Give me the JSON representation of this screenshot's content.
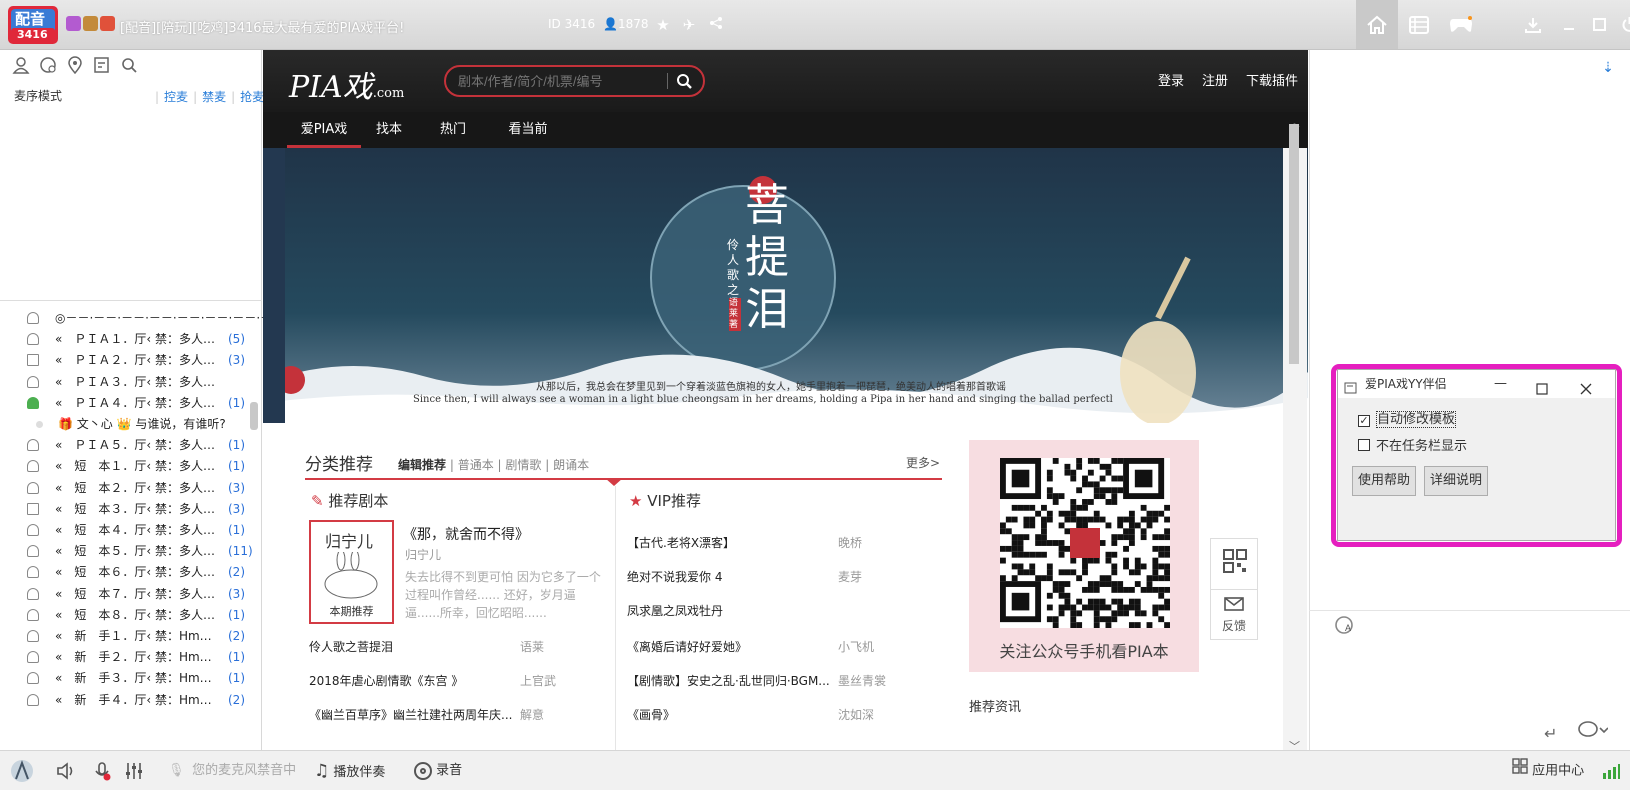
{
  "titlebar": {
    "logo_text": "配音",
    "logo_num": "3416",
    "title": "[配音][陪玩][吃鸡]3416最大最有爱的PIA戏平台!",
    "id": "ID 3416",
    "users": "1878",
    "right_icons": [
      "home-icon",
      "list-icon",
      "gamepad-icon",
      "download-icon",
      "minimize-icon",
      "maximize-icon",
      "power-icon"
    ]
  },
  "left": {
    "tools": [
      "user-icon",
      "chat-icon",
      "location-icon",
      "notes-icon",
      "search-icon"
    ],
    "mic_mode": "麦序模式",
    "links": [
      "控麦",
      "禁麦",
      "抢麦"
    ],
    "channels": [
      {
        "label": "◎－－·－－·－－·－－·－－·－－·－－·－－·－－·…",
        "num": "",
        "icon": "headset"
      },
      {
        "label": "«　ＰＩＡ１．厅‹ 禁：多人…",
        "num": "(5)",
        "icon": "headset"
      },
      {
        "label": "«　ＰＩＡ２．厅‹ 禁：多人…",
        "num": "(3)",
        "icon": "plus"
      },
      {
        "label": "«　ＰＩＡ３．厅‹ 禁：多人…",
        "num": "",
        "icon": "headset"
      },
      {
        "label": "«　ＰＩＡ４．厅‹ 禁：多人…",
        "num": "(1)",
        "icon": "green"
      },
      {
        "label": "🎁 文丶心 👑 与谁说，有谁听?",
        "num": "",
        "icon": "none"
      },
      {
        "label": "«　ＰＩＡ５．厅‹ 禁：多人…",
        "num": "(1)",
        "icon": "headset"
      },
      {
        "label": "«　短　本１．厅‹ 禁：多人…",
        "num": "(1)",
        "icon": "headset"
      },
      {
        "label": "«　短　本２．厅‹ 禁：多人…",
        "num": "(3)",
        "icon": "headset"
      },
      {
        "label": "«　短　本３．厅‹ 禁：多人…",
        "num": "(3)",
        "icon": "plus"
      },
      {
        "label": "«　短　本４．厅‹ 禁：多人…",
        "num": "(1)",
        "icon": "headset"
      },
      {
        "label": "«　短　本５．厅‹ 禁：多人…",
        "num": "(11)",
        "icon": "headset"
      },
      {
        "label": "«　短　本６．厅‹ 禁：多人…",
        "num": "(2)",
        "icon": "headset"
      },
      {
        "label": "«　短　本７．厅‹ 禁：多人…",
        "num": "(3)",
        "icon": "headset"
      },
      {
        "label": "«　短　本８．厅‹ 禁：多人…",
        "num": "(1)",
        "icon": "headset"
      },
      {
        "label": "«　新　手１．厅‹ 禁：Hm…",
        "num": "(2)",
        "icon": "headset"
      },
      {
        "label": "«　新　手２．厅‹ 禁：Hm…",
        "num": "(1)",
        "icon": "headset"
      },
      {
        "label": "«　新　手３．厅‹ 禁：Hm…",
        "num": "(1)",
        "icon": "headset"
      },
      {
        "label": "«　新　手４．厅‹ 禁：Hm…",
        "num": "(2)",
        "icon": "headset"
      }
    ]
  },
  "site": {
    "logo": "PIA戏",
    "logo_suffix": ".com",
    "search_placeholder": "剧本/作者/简介/机票/编号",
    "links": [
      "登录",
      "注册",
      "下载插件"
    ],
    "nav": [
      "爱PIA戏",
      "找本",
      "热门",
      "看当前"
    ],
    "banner": {
      "title": "菩提泪",
      "subtitle": "伶人歌之",
      "seal": "语莱著",
      "cn_line": "从那以后，我总会在梦里见到一个穿着淡蓝色旗袍的女人，她手里抱着一把琵琶，绝美动人的唱着那首歌谣",
      "en_line": "Since then, I will always see a woman in a light blue cheongsam in her dreams, holding a Pipa in her hand and singing the ballad perfectly."
    },
    "category": {
      "title": "分类推荐",
      "tabs": [
        "编辑推荐",
        "普通本",
        "剧情歌",
        "朗诵本"
      ],
      "more": "更多>"
    },
    "rec": {
      "title": "推荐剧本",
      "book_text": "归宁儿",
      "book_tag": "本期推荐",
      "feat_title": "《那，就舍而不得》",
      "feat_author": "归宁儿",
      "feat_desc": "失去比得不到更可怕 因为它多了一个过程叫作曾经...... 还好，岁月逼逼......所幸，回忆昭昭......",
      "list": [
        {
          "title": "伶人歌之菩提泪",
          "author": "语莱"
        },
        {
          "title": "2018年虐心剧情歌《东宫 》",
          "author": "上官武"
        },
        {
          "title": "《幽兰百草序》幽兰社建社两周年庆...",
          "author": "解意"
        }
      ]
    },
    "vip": {
      "title": "VIP推荐",
      "list": [
        {
          "title": "【古代.老将X漂客】",
          "author": "晚桥"
        },
        {
          "title": "绝对不说我爱你 4",
          "author": "麦芽"
        },
        {
          "title": "凤求凰之凤戏牡丹",
          "author": ""
        },
        {
          "title": "《离婚后请好好爱她》",
          "author": "小飞机"
        },
        {
          "title": "【剧情歌】安史之乱·乱世同归·BGM...",
          "author": "墨丝青裳"
        },
        {
          "title": "《画骨》",
          "author": "沈如深"
        }
      ]
    },
    "qr_caption": "关注公众号手机看PIA本",
    "news_title": "推荐资讯",
    "float": {
      "feedback": "反馈"
    }
  },
  "dialog": {
    "title": "爱PIA戏YY伴侣",
    "cb1": "自动修改模板",
    "cb1_checked": true,
    "cb2": "不在任务栏显示",
    "cb2_checked": false,
    "btn1": "使用帮助",
    "btn2": "详细说明"
  },
  "bottom": {
    "mic_status": "您的麦克风禁音中",
    "play": "播放伴奏",
    "record": "录音",
    "app_center": "应用中心"
  },
  "colors": {
    "accent": "#c4323a",
    "dialog_highlight": "#e51fbf",
    "link": "#2a7ed8"
  }
}
